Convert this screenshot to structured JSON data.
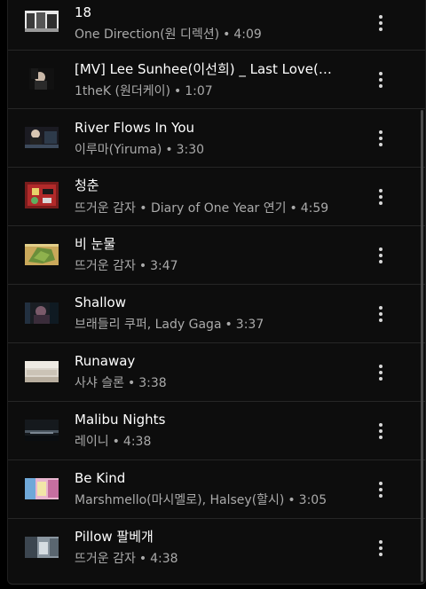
{
  "songs": [
    {
      "title": "18",
      "artist": "One Direction(원 디렉션)",
      "duration": "4:09",
      "thumb": "one-direction-thumb"
    },
    {
      "title": "[MV] Lee Sunhee(이선희) _ Last Love(끝…",
      "artist": "1theK (원더케이)",
      "duration": "1:07",
      "thumb": "lee-sunhee-thumb"
    },
    {
      "title": "River Flows In You",
      "artist": "이루마(Yiruma)",
      "duration": "3:30",
      "thumb": "yiruma-thumb"
    },
    {
      "title": "청춘",
      "artist": "뜨거운 감자 • Diary of One Year 연기",
      "duration": "4:59",
      "thumb": "cheongchun-thumb"
    },
    {
      "title": "비 눈물",
      "artist": "뜨거운 감자",
      "duration": "3:47",
      "thumb": "bi-nunmul-thumb"
    },
    {
      "title": "Shallow",
      "artist": "브래들리 쿠퍼, Lady Gaga",
      "duration": "3:37",
      "thumb": "shallow-thumb"
    },
    {
      "title": "Runaway",
      "artist": "사샤 슬론",
      "duration": "3:38",
      "thumb": "runaway-thumb"
    },
    {
      "title": "Malibu Nights",
      "artist": "레이니",
      "duration": "4:38",
      "thumb": "malibu-nights-thumb"
    },
    {
      "title": "Be Kind",
      "artist": "Marshmello(마시멜로), Halsey(할시)",
      "duration": "3:05",
      "thumb": "be-kind-thumb"
    },
    {
      "title": "Pillow 팔베개",
      "artist": "뜨거운 감자",
      "duration": "4:38",
      "thumb": "pillow-thumb"
    }
  ],
  "separator": "•",
  "more_icon": "more-vert-icon",
  "colors": {
    "background": "#0d0d0d",
    "title": "#ffffff",
    "subtitle": "#aaaaaa",
    "divider": "#262626"
  }
}
